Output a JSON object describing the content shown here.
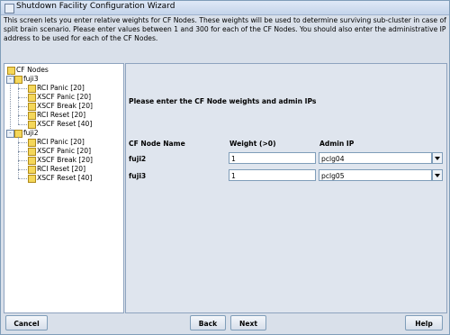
{
  "window": {
    "title": "Shutdown Facility Configuration Wizard"
  },
  "description": "This screen lets you enter relative weights for CF Nodes. These weights will be used to determine surviving sub-cluster in case of split brain scenario. Please enter values between 1 and 300 for each of the CF Nodes. You should also enter the administrative IP address to be used for each of the CF Nodes.",
  "tree": {
    "root": "CF Nodes",
    "nodes": [
      {
        "name": "fuji3",
        "items": [
          "RCI Panic [20]",
          "XSCF Panic [20]",
          "XSCF Break [20]",
          "RCI Reset [20]",
          "XSCF Reset [40]"
        ]
      },
      {
        "name": "fuji2",
        "items": [
          "RCI Panic [20]",
          "XSCF Panic [20]",
          "XSCF Break [20]",
          "RCI Reset [20]",
          "XSCF Reset [40]"
        ]
      }
    ]
  },
  "form": {
    "heading": "Please enter the CF Node weights and admin IPs",
    "columns": {
      "name": "CF Node Name",
      "weight": "Weight (>0)",
      "admin_ip": "Admin IP"
    },
    "rows": [
      {
        "name": "fuji2",
        "weight": "1",
        "admin_ip": "pclg04"
      },
      {
        "name": "fuji3",
        "weight": "1",
        "admin_ip": "pclg05"
      }
    ]
  },
  "buttons": {
    "cancel": "Cancel",
    "back": "Back",
    "next": "Next",
    "help": "Help"
  }
}
